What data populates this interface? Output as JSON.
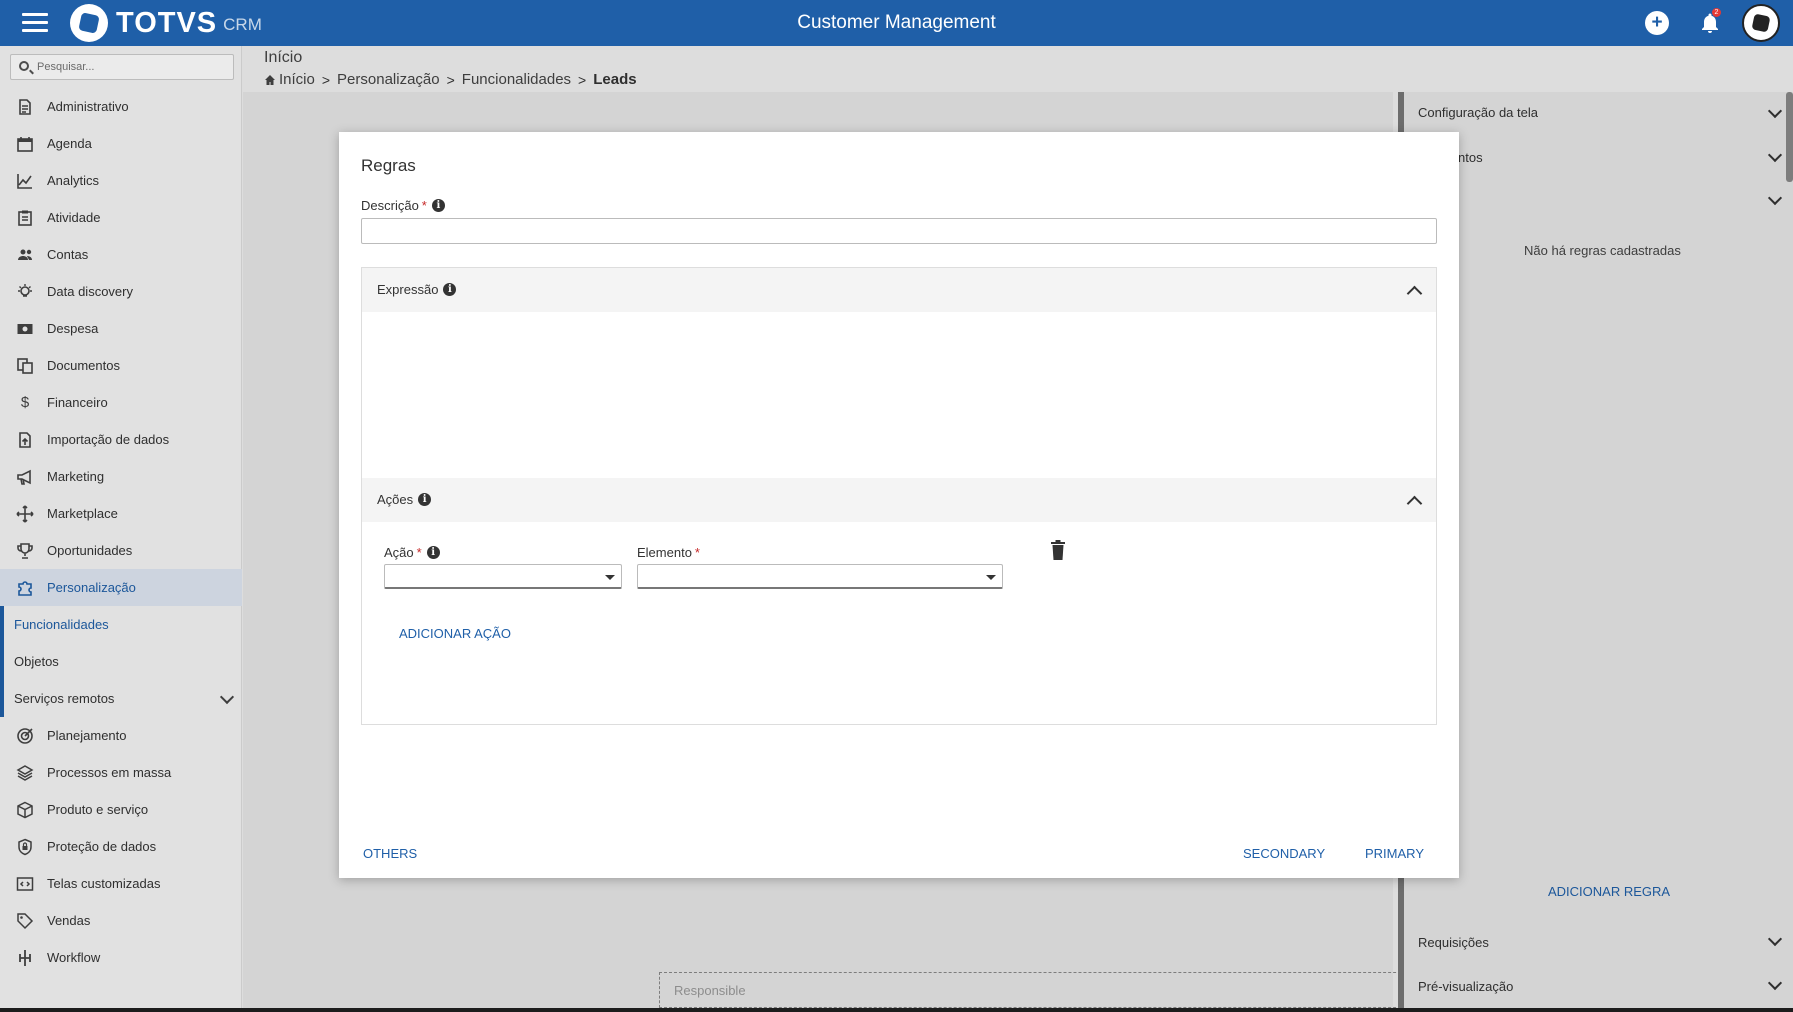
{
  "header": {
    "logo_text": "TOTVS",
    "logo_sub": "CRM",
    "app_title": "Customer Management",
    "notification_count": "2"
  },
  "sidebar": {
    "search_placeholder": "Pesquisar...",
    "items": [
      {
        "label": "Administrativo",
        "icon": "document-icon"
      },
      {
        "label": "Agenda",
        "icon": "calendar-icon"
      },
      {
        "label": "Analytics",
        "icon": "chart-line-icon"
      },
      {
        "label": "Atividade",
        "icon": "clipboard-icon"
      },
      {
        "label": "Contas",
        "icon": "people-icon"
      },
      {
        "label": "Data discovery",
        "icon": "lightbulb-icon"
      },
      {
        "label": "Despesa",
        "icon": "money-icon"
      },
      {
        "label": "Documentos",
        "icon": "documents-icon"
      },
      {
        "label": "Financeiro",
        "icon": "dollar-icon"
      },
      {
        "label": "Importação de dados",
        "icon": "file-upload-icon"
      },
      {
        "label": "Marketing",
        "icon": "megaphone-icon"
      },
      {
        "label": "Marketplace",
        "icon": "move-arrows-icon"
      },
      {
        "label": "Oportunidades",
        "icon": "trophy-icon"
      },
      {
        "label": "Personalização",
        "icon": "puzzle-icon"
      }
    ],
    "sub_items": [
      {
        "label": "Funcionalidades"
      },
      {
        "label": "Objetos"
      },
      {
        "label": "Serviços remotos"
      }
    ],
    "items_after": [
      {
        "label": "Planejamento",
        "icon": "target-icon"
      },
      {
        "label": "Processos em massa",
        "icon": "layers-icon"
      },
      {
        "label": "Produto e serviço",
        "icon": "box-icon"
      },
      {
        "label": "Proteção de dados",
        "icon": "shield-lock-icon"
      },
      {
        "label": "Telas customizadas",
        "icon": "code-screen-icon"
      },
      {
        "label": "Vendas",
        "icon": "tag-icon"
      },
      {
        "label": "Workflow",
        "icon": "workflow-icon"
      }
    ]
  },
  "page": {
    "title": "Início",
    "breadcrumb": [
      "Início",
      "Personalização",
      "Funcionalidades",
      "Leads"
    ]
  },
  "right_panel": {
    "config": "Configuração da tela",
    "eventos": "ntos",
    "empty": "Não há regras cadastradas",
    "add_rule": "ADICIONAR REGRA",
    "requisicoes": "Requisições",
    "preview": "Pré-visualização"
  },
  "canvas": {
    "responsible": "Responsible"
  },
  "modal": {
    "title": "Regras",
    "description_label": "Descrição",
    "description_value": "",
    "expression_label": "Expressão",
    "actions_label": "Ações",
    "action_label": "Ação",
    "element_label": "Elemento",
    "action_value": "",
    "element_value": "",
    "add_action": "ADICIONAR AÇÃO",
    "others": "OTHERS",
    "secondary": "SECONDARY",
    "primary": "PRIMARY",
    "required_mark": "*",
    "info_mark": "i"
  },
  "colors": {
    "brand": "#1f5fa8",
    "required": "#c62828"
  }
}
